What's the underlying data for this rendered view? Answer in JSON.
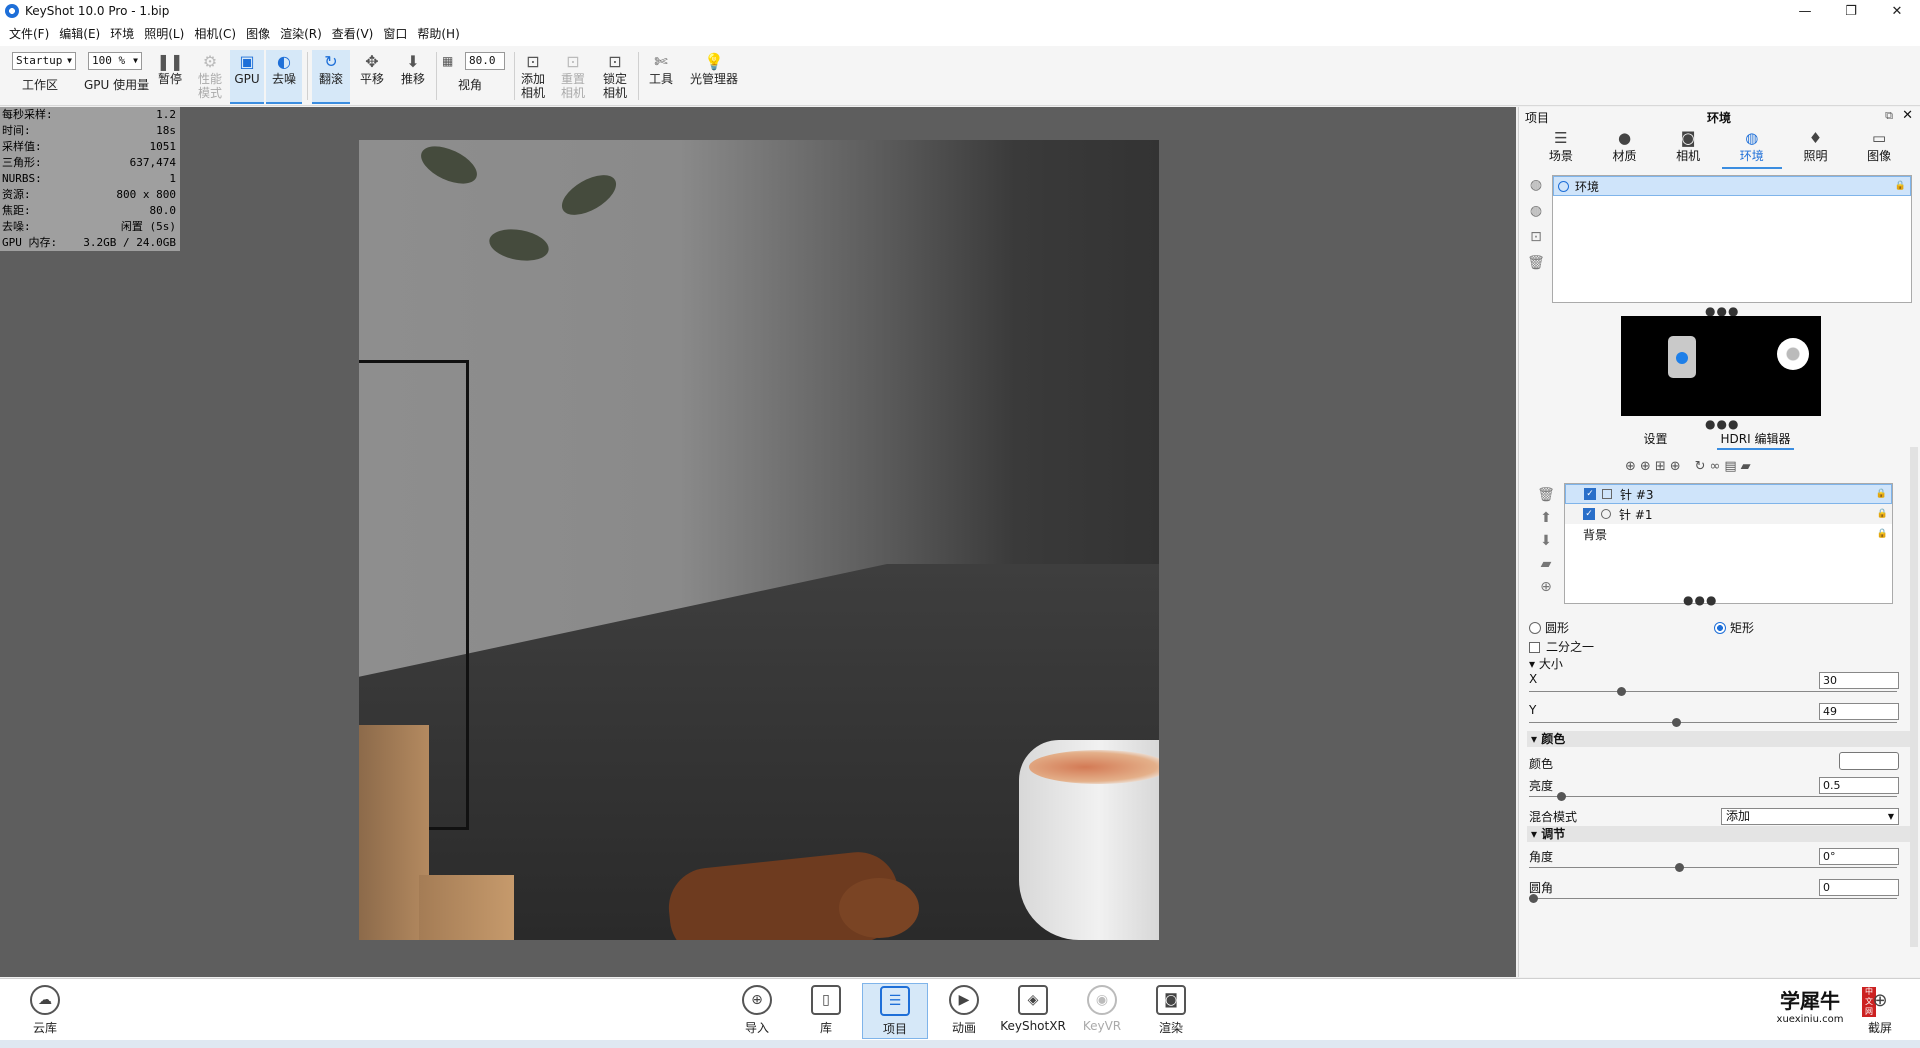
{
  "window": {
    "title": "KeyShot 10.0 Pro  -  1.bip",
    "minimize": "—",
    "maximize": "❐",
    "close": "✕"
  },
  "menu": [
    "文件(F)",
    "编辑(E)",
    "环境",
    "照明(L)",
    "相机(C)",
    "图像",
    "渲染(R)",
    "查看(V)",
    "窗口",
    "帮助(H)"
  ],
  "toolbar": {
    "workspace_value": "Startup",
    "workspace_label": "工作区",
    "gpu_usage_value": "100 %",
    "gpu_usage_label": "GPU 使用量",
    "pause_label": "暂停",
    "perf_mode_label": "性能\n模式",
    "gpu_label": "GPU",
    "denoise_label": "去噪",
    "tumble_label": "翻滚",
    "pan_label": "平移",
    "dolly_label": "推移",
    "fov_value": "80.0",
    "fov_label": "视角",
    "add_camera_label": "添加\n相机",
    "reset_camera_label": "重置\n相机",
    "lock_camera_label": "锁定\n相机",
    "tools_label": "工具",
    "light_manager_label": "光管理器"
  },
  "stats": [
    {
      "label": "每秒采样:",
      "value": "1.2"
    },
    {
      "label": "时间:",
      "value": "18s"
    },
    {
      "label": "采样值:",
      "value": "1051"
    },
    {
      "label": "三角形:",
      "value": "637,474"
    },
    {
      "label": "NURBS:",
      "value": "1"
    },
    {
      "label": "资源:",
      "value": "800 x 800"
    },
    {
      "label": "焦距:",
      "value": "80.0"
    },
    {
      "label": "去噪:",
      "value": "闲置 (5s)"
    },
    {
      "label": "GPU 内存:",
      "value": "3.2GB / 24.0GB"
    }
  ],
  "panel": {
    "project_label": "项目",
    "title": "环境",
    "tabs": [
      "场景",
      "材质",
      "相机",
      "环境",
      "照明",
      "图像"
    ],
    "env_item": "环境",
    "subtabs": [
      "设置",
      "HDRI 编辑器"
    ],
    "lights": [
      "针 #3",
      "针 #1",
      "背景"
    ],
    "shape_circle": "圆形",
    "shape_rect": "矩形",
    "half_label": "二分之一",
    "size_label": "▾ 大小",
    "x_label": "X",
    "x_value": "30",
    "y_label": "Y",
    "y_value": "49",
    "color_section": "颜色",
    "color_label": "颜色",
    "brightness_label": "亮度",
    "brightness_value": "0.5",
    "blend_label": "混合模式",
    "blend_value": "添加",
    "adjust_section": "调节",
    "angle_label": "角度",
    "angle_value": "0°",
    "rounding_label": "圆角",
    "rounding_value": "0"
  },
  "bottom": {
    "cloud_label": "云库",
    "import_label": "导入",
    "library_label": "库",
    "project_label": "项目",
    "animation_label": "动画",
    "keyshotxr_label": "KeyShotXR",
    "keyvr_label": "KeyVR",
    "render_label": "渲染",
    "screenshot_label": "截屏",
    "watermark_main": "学犀牛",
    "watermark_url": "xuexiniu.com",
    "watermark_badge": "中文网"
  }
}
